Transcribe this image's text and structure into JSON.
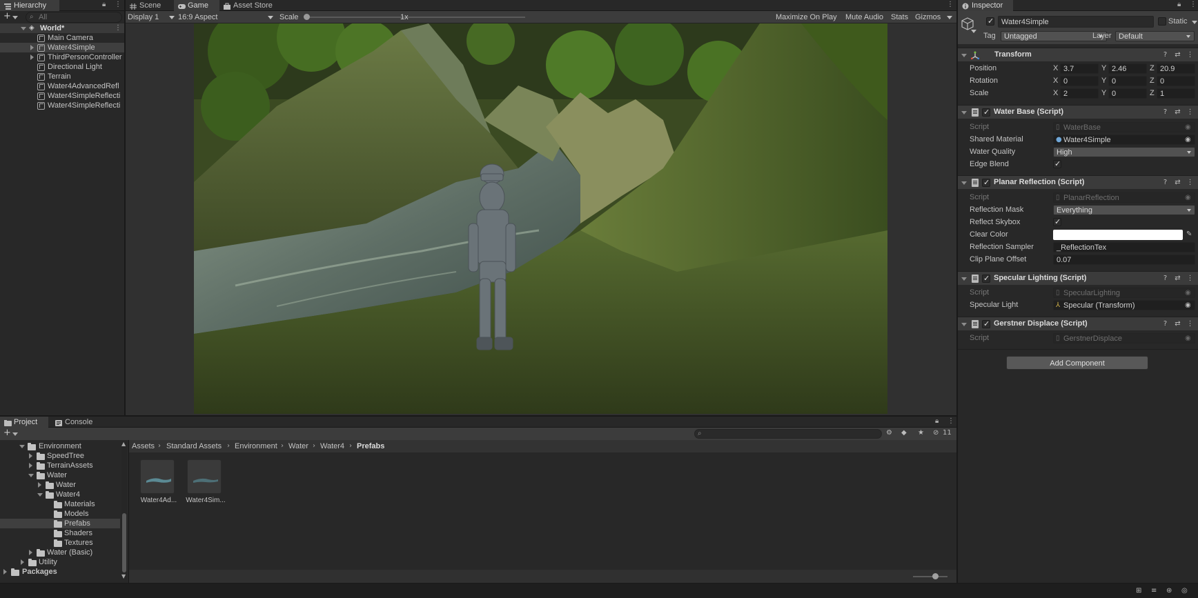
{
  "hierarchy": {
    "tab_label": "Hierarchy",
    "search_placeholder": "All",
    "scene_name": "World*",
    "items": [
      {
        "label": "Main Camera"
      },
      {
        "label": "Water4Simple"
      },
      {
        "label": "ThirdPersonController"
      },
      {
        "label": "Directional Light"
      },
      {
        "label": "Terrain"
      },
      {
        "label": "Water4AdvancedRefl"
      },
      {
        "label": "Water4SimpleReflecti"
      },
      {
        "label": "Water4SimpleReflecti"
      }
    ]
  },
  "view_tabs": {
    "scene": "Scene",
    "game": "Game",
    "asset_store": "Asset Store"
  },
  "game_toolbar": {
    "display": "Display 1",
    "aspect": "16:9 Aspect",
    "scale_label": "Scale",
    "scale_value": "1x",
    "maximize": "Maximize On Play",
    "mute": "Mute Audio",
    "stats": "Stats",
    "gizmos": "Gizmos"
  },
  "inspector": {
    "tab_label": "Inspector",
    "object_name": "Water4Simple",
    "static_label": "Static",
    "tag_label": "Tag",
    "tag_value": "Untagged",
    "layer_label": "Layer",
    "layer_value": "Default",
    "transform": {
      "title": "Transform",
      "position_label": "Position",
      "rotation_label": "Rotation",
      "scale_label": "Scale",
      "position": {
        "x": "3.7",
        "y": "2.46",
        "z": "20.9"
      },
      "rotation": {
        "x": "0",
        "y": "0",
        "z": "0"
      },
      "scale": {
        "x": "2",
        "y": "0",
        "z": "1"
      }
    },
    "water_base": {
      "title": "Water Base (Script)",
      "script_label": "Script",
      "script_value": "WaterBase",
      "material_label": "Shared Material",
      "material_value": "Water4Simple",
      "quality_label": "Water Quality",
      "quality_value": "High",
      "edge_label": "Edge Blend"
    },
    "planar_reflection": {
      "title": "Planar Reflection (Script)",
      "script_label": "Script",
      "script_value": "PlanarReflection",
      "mask_label": "Reflection Mask",
      "mask_value": "Everything",
      "skybox_label": "Reflect Skybox",
      "clear_color_label": "Clear Color",
      "sampler_label": "Reflection Sampler",
      "sampler_value": "_ReflectionTex",
      "clip_label": "Clip Plane Offset",
      "clip_value": "0.07"
    },
    "specular_lighting": {
      "title": "Specular Lighting (Script)",
      "script_label": "Script",
      "script_value": "SpecularLighting",
      "light_label": "Specular Light",
      "light_value": "Specular (Transform)"
    },
    "gerstner": {
      "title": "Gerstner Displace (Script)",
      "script_label": "Script",
      "script_value": "GerstnerDisplace"
    },
    "add_component": "Add Component"
  },
  "project": {
    "tab_project": "Project",
    "tab_console": "Console",
    "hidden_count": "11",
    "tree": [
      {
        "label": "Environment"
      },
      {
        "label": "SpeedTree"
      },
      {
        "label": "TerrainAssets"
      },
      {
        "label": "Water"
      },
      {
        "label": "Water"
      },
      {
        "label": "Water4"
      },
      {
        "label": "Materials"
      },
      {
        "label": "Models"
      },
      {
        "label": "Prefabs"
      },
      {
        "label": "Shaders"
      },
      {
        "label": "Textures"
      },
      {
        "label": "Water (Basic)"
      },
      {
        "label": "Utility"
      },
      {
        "label": "Packages"
      }
    ],
    "breadcrumb": [
      "Assets",
      "Standard Assets",
      "Environment",
      "Water",
      "Water4",
      "Prefabs"
    ],
    "assets": [
      {
        "label": "Water4Ad..."
      },
      {
        "label": "Water4Sim..."
      }
    ]
  },
  "colors": {
    "bg": "#282828",
    "header": "#3b3b3b",
    "selection": "#3f3f3f",
    "field": "#1f1f1f"
  }
}
